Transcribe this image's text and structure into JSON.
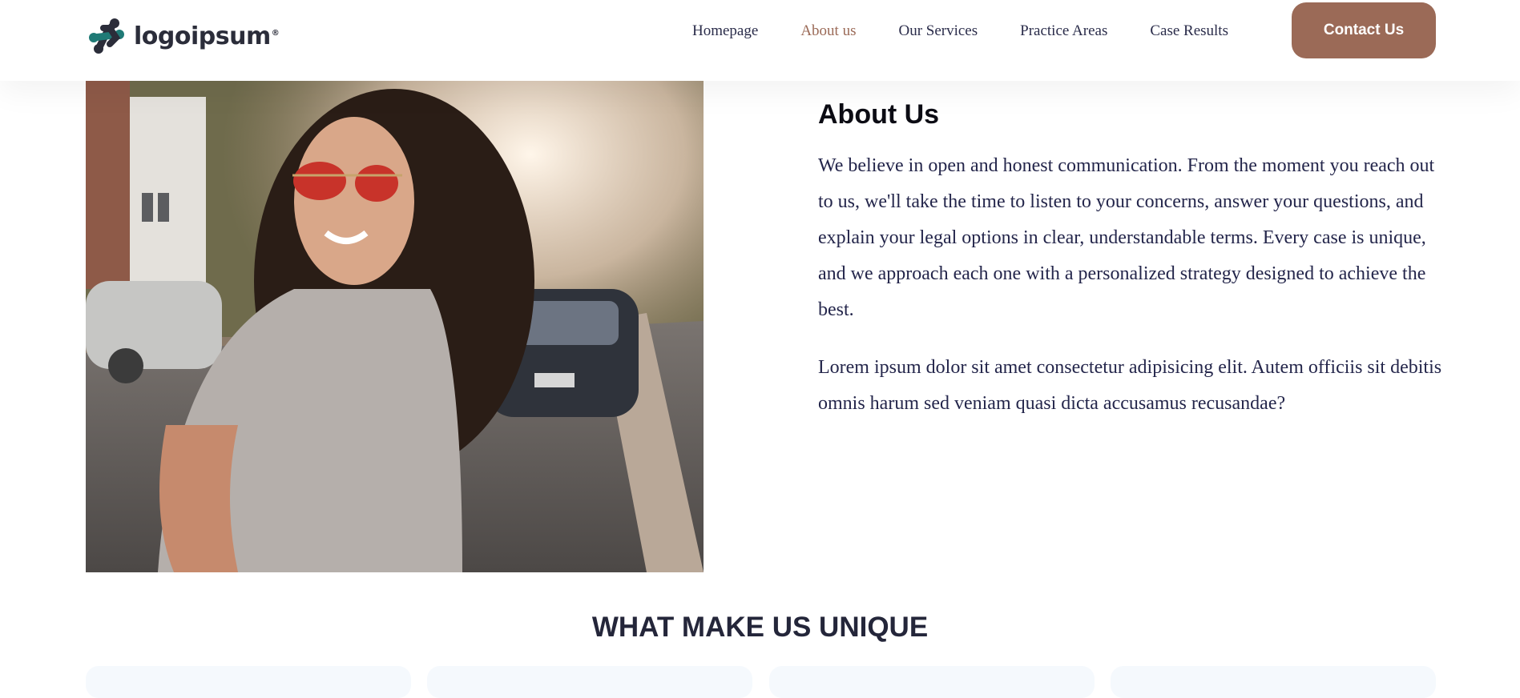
{
  "brand": {
    "name": "logoipsum",
    "mark": "®",
    "color": "#2b2d3a",
    "accent": "#1f7a76"
  },
  "nav": {
    "items": [
      {
        "label": "Homepage",
        "active": false
      },
      {
        "label": "About us",
        "active": true
      },
      {
        "label": "Our Services",
        "active": false
      },
      {
        "label": "Practice Areas",
        "active": false
      },
      {
        "label": "Case Results",
        "active": false
      }
    ],
    "contact_label": "Contact Us",
    "active_color": "#9b6a57"
  },
  "about": {
    "title": "About Us",
    "paragraph1": "We believe in open and honest communication. From the moment you reach out to us, we'll take the time to listen to your concerns, answer your questions, and explain your legal options in clear, understandable terms. Every case is unique, and we approach each one with a personalized strategy designed to achieve the best.",
    "paragraph2": "Lorem ipsum dolor sit amet consectetur adipisicing elit. Autem officiis sit debitis omnis harum sed veniam quasi dicta accusamus recusandae?"
  },
  "unique": {
    "title": "WHAT MAKE US UNIQUE",
    "card_count": 4
  }
}
